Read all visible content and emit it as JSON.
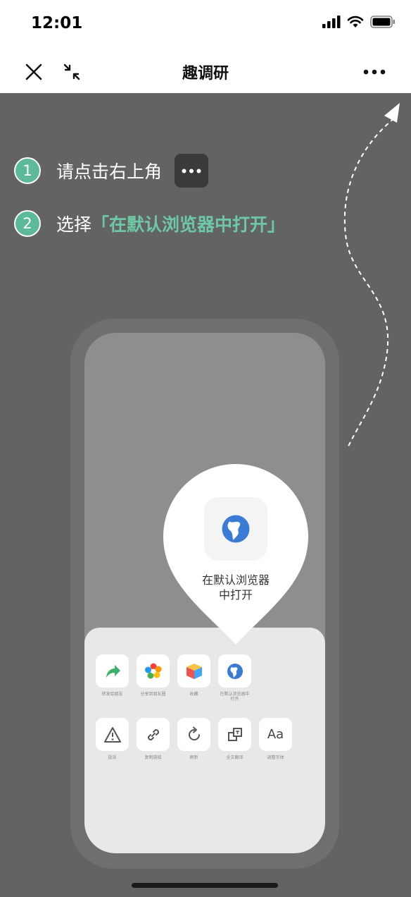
{
  "status_bar": {
    "time": "12:01"
  },
  "nav": {
    "title": "趣调研"
  },
  "steps": [
    {
      "num": "1",
      "text": "请点击右上角"
    },
    {
      "num": "2",
      "text": "选择",
      "highlight": "「在默认浏览器中打开」"
    }
  ],
  "pin": {
    "label_line1": "在默认浏览器",
    "label_line2": "中打开"
  },
  "share_grid": {
    "row1": [
      {
        "label": "转发给朋友",
        "icon": "forward-arrow-icon"
      },
      {
        "label": "分享到朋友圈",
        "icon": "moments-icon"
      },
      {
        "label": "收藏",
        "icon": "favorite-cube-icon"
      },
      {
        "label": "在默认浏览器中打开",
        "icon": "globe-icon"
      }
    ],
    "row2": [
      {
        "label": "投诉",
        "icon": "warning-icon"
      },
      {
        "label": "复制链接",
        "icon": "link-icon"
      },
      {
        "label": "刷新",
        "icon": "refresh-icon"
      },
      {
        "label": "全文翻译",
        "icon": "translate-icon"
      },
      {
        "label": "调整字体",
        "icon": "font-size-icon",
        "glyph": "Aa"
      }
    ]
  },
  "colors": {
    "accent": "#5cb99a",
    "highlight": "#6dc9a5",
    "overlay": "#636363"
  }
}
